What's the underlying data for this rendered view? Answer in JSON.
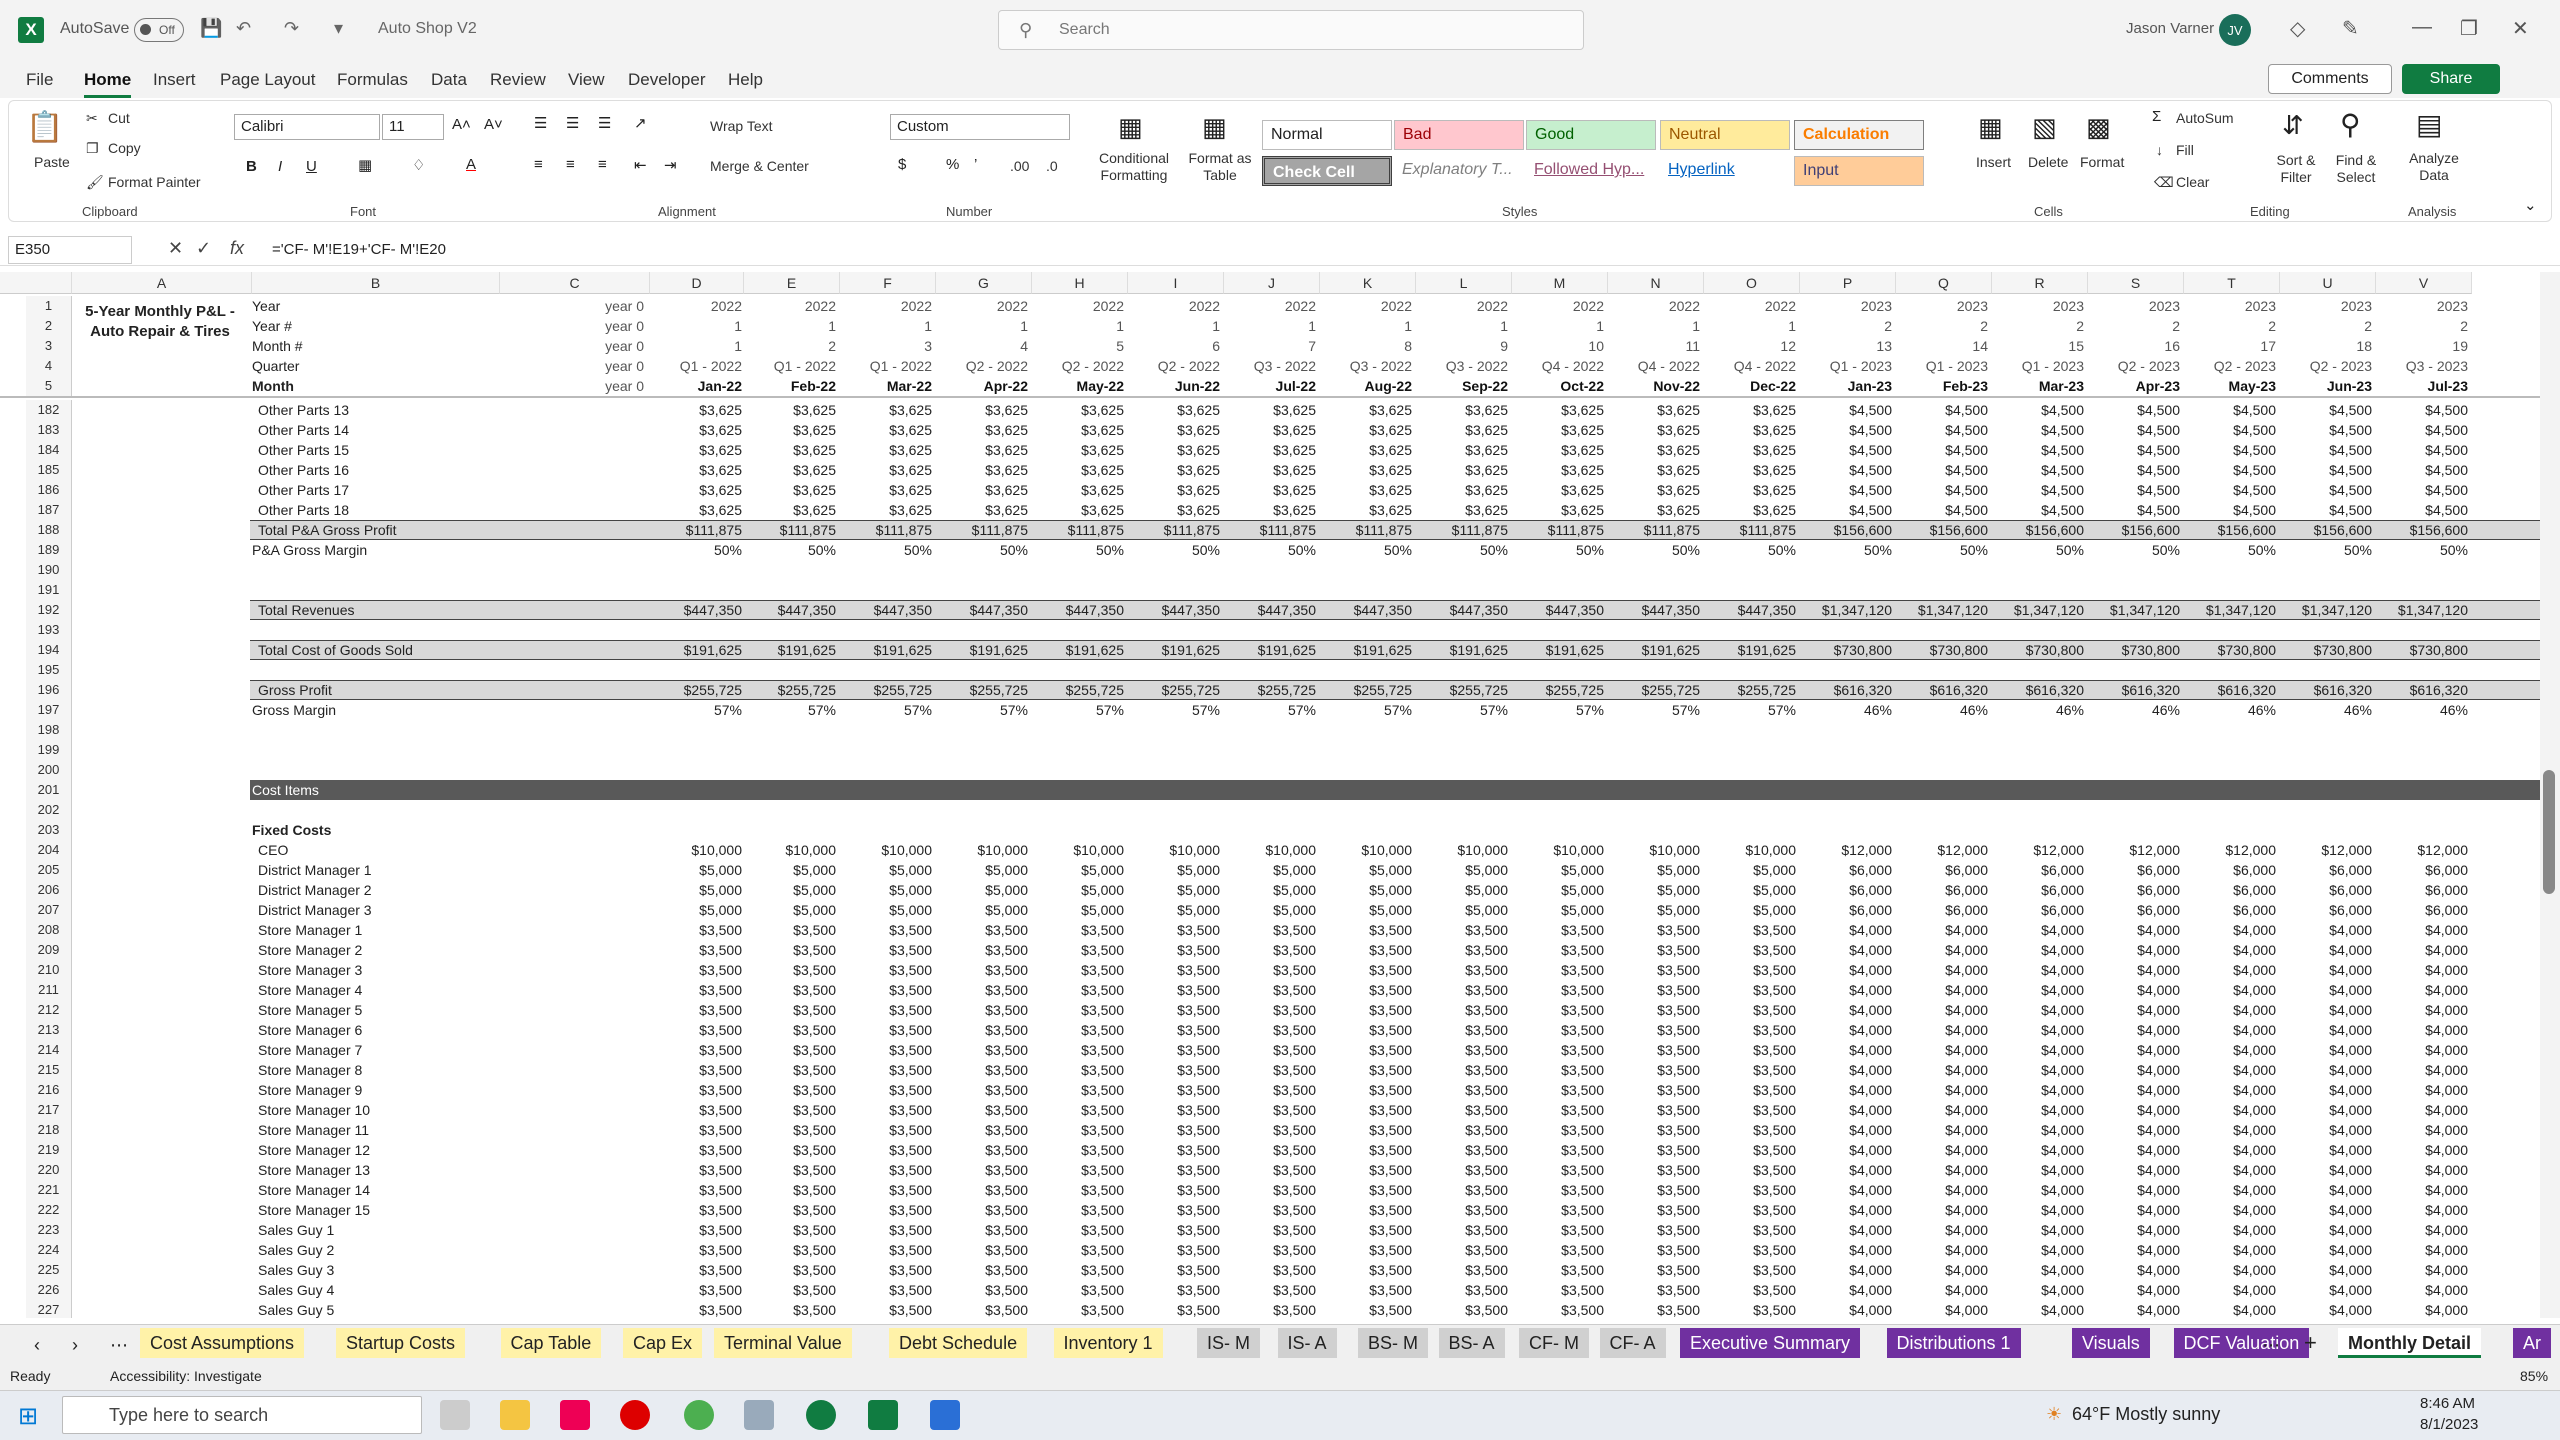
{
  "titlebar": {
    "autosave": "AutoSave",
    "toggle": "Off",
    "doc_title": "Auto Shop V2",
    "search_placeholder": "Search",
    "user": "Jason Varner",
    "initials": "JV"
  },
  "menu": [
    "File",
    "Home",
    "Insert",
    "Page Layout",
    "Formulas",
    "Data",
    "Review",
    "View",
    "Developer",
    "Help"
  ],
  "comments": "Comments",
  "share": "Share",
  "ribbon": {
    "paste": "Paste",
    "cut": "Cut",
    "copy": "Copy",
    "format_painter": "Format Painter",
    "clipboard": "Clipboard",
    "font_name": "Calibri",
    "font_size": "11",
    "font": "Font",
    "wrap_text": "Wrap Text",
    "merge_center": "Merge & Center",
    "alignment": "Alignment",
    "number_format": "Custom",
    "number": "Number",
    "conditional_formatting": "Conditional Formatting",
    "format_as_table": "Format as Table",
    "styles": "Styles",
    "style_normal": "Normal",
    "style_bad": "Bad",
    "style_good": "Good",
    "style_neutral": "Neutral",
    "style_calculation": "Calculation",
    "style_check": "Check Cell",
    "style_explanatory": "Explanatory T...",
    "style_followed": "Followed Hyp...",
    "style_hyperlink": "Hyperlink",
    "style_input": "Input",
    "insert": "Insert",
    "delete": "Delete",
    "format": "Format",
    "cells": "Cells",
    "autosum": "AutoSum",
    "fill": "Fill",
    "clear": "Clear",
    "sort_filter": "Sort & Filter",
    "find_select": "Find & Select",
    "editing": "Editing",
    "analyze_data": "Analyze Data",
    "analysis": "Analysis"
  },
  "formula_bar": {
    "name_box": "E350",
    "formula": "='CF- M'!E19+'CF- M'!E20"
  },
  "sheet": {
    "title": "5-Year Monthly P&L - Auto Repair & Tires",
    "columns": [
      "A",
      "B",
      "C",
      "D",
      "E",
      "F",
      "G",
      "H",
      "I",
      "J",
      "K",
      "L",
      "M",
      "N",
      "O",
      "P",
      "Q",
      "R",
      "S",
      "T",
      "U",
      "V"
    ],
    "header_rows": [
      {
        "n": "1",
        "label": "Year",
        "c": "year 0",
        "vals": [
          "2022",
          "2022",
          "2022",
          "2022",
          "2022",
          "2022",
          "2022",
          "2022",
          "2022",
          "2022",
          "2022",
          "2022",
          "2023",
          "2023",
          "2023",
          "2023",
          "2023",
          "2023",
          "2023"
        ]
      },
      {
        "n": "2",
        "label": "Year #",
        "c": "year 0",
        "vals": [
          "1",
          "1",
          "1",
          "1",
          "1",
          "1",
          "1",
          "1",
          "1",
          "1",
          "1",
          "1",
          "2",
          "2",
          "2",
          "2",
          "2",
          "2",
          "2"
        ]
      },
      {
        "n": "3",
        "label": "Month #",
        "c": "year 0",
        "vals": [
          "1",
          "2",
          "3",
          "4",
          "5",
          "6",
          "7",
          "8",
          "9",
          "10",
          "11",
          "12",
          "13",
          "14",
          "15",
          "16",
          "17",
          "18",
          "19"
        ]
      },
      {
        "n": "4",
        "label": "Quarter",
        "c": "year 0",
        "vals": [
          "Q1 - 2022",
          "Q1 - 2022",
          "Q1 - 2022",
          "Q2 - 2022",
          "Q2 - 2022",
          "Q2 - 2022",
          "Q3 - 2022",
          "Q3 - 2022",
          "Q3 - 2022",
          "Q4 - 2022",
          "Q4 - 2022",
          "Q4 - 2022",
          "Q1 - 2023",
          "Q1 - 2023",
          "Q1 - 2023",
          "Q2 - 2023",
          "Q2 - 2023",
          "Q2 - 2023",
          "Q3 - 2023"
        ]
      },
      {
        "n": "5",
        "label": "Month",
        "c": "year 0",
        "vals": [
          "Jan-22",
          "Feb-22",
          "Mar-22",
          "Apr-22",
          "May-22",
          "Jun-22",
          "Jul-22",
          "Aug-22",
          "Sep-22",
          "Oct-22",
          "Nov-22",
          "Dec-22",
          "Jan-23",
          "Feb-23",
          "Mar-23",
          "Apr-23",
          "May-23",
          "Jun-23",
          "Jul-23"
        ]
      }
    ],
    "rows": [
      {
        "n": "182",
        "label": "Other Parts 13",
        "a": "$3,625",
        "b": "$4,500"
      },
      {
        "n": "183",
        "label": "Other Parts 14",
        "a": "$3,625",
        "b": "$4,500"
      },
      {
        "n": "184",
        "label": "Other Parts 15",
        "a": "$3,625",
        "b": "$4,500"
      },
      {
        "n": "185",
        "label": "Other Parts 16",
        "a": "$3,625",
        "b": "$4,500"
      },
      {
        "n": "186",
        "label": "Other Parts 17",
        "a": "$3,625",
        "b": "$4,500"
      },
      {
        "n": "187",
        "label": "Other Parts 18",
        "a": "$3,625",
        "b": "$4,500"
      },
      {
        "n": "188",
        "label": "Total P&A Gross Profit",
        "a": "$111,875",
        "b": "$156,600",
        "style": "hl"
      },
      {
        "n": "189",
        "label": "P&A Gross Margin",
        "a": "50%",
        "b": "50%"
      },
      {
        "n": "190",
        "label": "",
        "a": "",
        "b": ""
      },
      {
        "n": "191",
        "label": "",
        "a": "",
        "b": ""
      },
      {
        "n": "192",
        "label": "Total Revenues",
        "a": "$447,350",
        "b": "$1,347,120",
        "style": "hl"
      },
      {
        "n": "193",
        "label": "",
        "a": "",
        "b": ""
      },
      {
        "n": "194",
        "label": "Total Cost of Goods Sold",
        "a": "$191,625",
        "b": "$730,800",
        "style": "hl"
      },
      {
        "n": "195",
        "label": "",
        "a": "",
        "b": ""
      },
      {
        "n": "196",
        "label": "Gross Profit",
        "a": "$255,725",
        "b": "$616,320",
        "style": "hl"
      },
      {
        "n": "197",
        "label": "Gross Margin",
        "a": "57%",
        "b": "46%"
      },
      {
        "n": "198",
        "label": "",
        "a": "",
        "b": ""
      },
      {
        "n": "199",
        "label": "",
        "a": "",
        "b": ""
      },
      {
        "n": "200",
        "label": "",
        "a": "",
        "b": ""
      },
      {
        "n": "201",
        "label": "Cost Items",
        "a": "",
        "b": "",
        "style": "dark"
      },
      {
        "n": "202",
        "label": "",
        "a": "",
        "b": ""
      },
      {
        "n": "203",
        "label": "Fixed Costs",
        "a": "",
        "b": "",
        "style": "bold"
      },
      {
        "n": "204",
        "label": "CEO",
        "a": "$10,000",
        "b": "$12,000"
      },
      {
        "n": "205",
        "label": "District Manager 1",
        "a": "$5,000",
        "b": "$6,000"
      },
      {
        "n": "206",
        "label": "District Manager 2",
        "a": "$5,000",
        "b": "$6,000"
      },
      {
        "n": "207",
        "label": "District Manager 3",
        "a": "$5,000",
        "b": "$6,000"
      },
      {
        "n": "208",
        "label": "Store Manager 1",
        "a": "$3,500",
        "b": "$4,000"
      },
      {
        "n": "209",
        "label": "Store Manager 2",
        "a": "$3,500",
        "b": "$4,000"
      },
      {
        "n": "210",
        "label": "Store Manager 3",
        "a": "$3,500",
        "b": "$4,000"
      },
      {
        "n": "211",
        "label": "Store Manager 4",
        "a": "$3,500",
        "b": "$4,000"
      },
      {
        "n": "212",
        "label": "Store Manager 5",
        "a": "$3,500",
        "b": "$4,000"
      },
      {
        "n": "213",
        "label": "Store Manager 6",
        "a": "$3,500",
        "b": "$4,000"
      },
      {
        "n": "214",
        "label": "Store Manager 7",
        "a": "$3,500",
        "b": "$4,000"
      },
      {
        "n": "215",
        "label": "Store Manager 8",
        "a": "$3,500",
        "b": "$4,000"
      },
      {
        "n": "216",
        "label": "Store Manager 9",
        "a": "$3,500",
        "b": "$4,000"
      },
      {
        "n": "217",
        "label": "Store Manager 10",
        "a": "$3,500",
        "b": "$4,000"
      },
      {
        "n": "218",
        "label": "Store Manager 11",
        "a": "$3,500",
        "b": "$4,000"
      },
      {
        "n": "219",
        "label": "Store Manager 12",
        "a": "$3,500",
        "b": "$4,000"
      },
      {
        "n": "220",
        "label": "Store Manager 13",
        "a": "$3,500",
        "b": "$4,000"
      },
      {
        "n": "221",
        "label": "Store Manager 14",
        "a": "$3,500",
        "b": "$4,000"
      },
      {
        "n": "222",
        "label": "Store Manager 15",
        "a": "$3,500",
        "b": "$4,000"
      },
      {
        "n": "223",
        "label": "Sales Guy 1",
        "a": "$3,500",
        "b": "$4,000"
      },
      {
        "n": "224",
        "label": "Sales Guy 2",
        "a": "$3,500",
        "b": "$4,000"
      },
      {
        "n": "225",
        "label": "Sales Guy 3",
        "a": "$3,500",
        "b": "$4,000"
      },
      {
        "n": "226",
        "label": "Sales Guy 4",
        "a": "$3,500",
        "b": "$4,000"
      },
      {
        "n": "227",
        "label": "Sales Guy 5",
        "a": "$3,500",
        "b": "$4,000"
      }
    ]
  },
  "tabs": [
    {
      "label": "Cost Assumptions",
      "color": "#fff2a8",
      "fg": "#222"
    },
    {
      "label": "Startup Costs",
      "color": "#fff2a8",
      "fg": "#222"
    },
    {
      "label": "Cap Table",
      "color": "#fff2a8",
      "fg": "#222"
    },
    {
      "label": "Cap Ex",
      "color": "#fff2a8",
      "fg": "#222"
    },
    {
      "label": "Terminal Value",
      "color": "#fff2a8",
      "fg": "#222"
    },
    {
      "label": "Debt Schedule",
      "color": "#fff2a8",
      "fg": "#222"
    },
    {
      "label": "Inventory 1",
      "color": "#fff2a8",
      "fg": "#222"
    },
    {
      "label": "IS- M",
      "color": "#d0d0d0",
      "fg": "#222"
    },
    {
      "label": "IS- A",
      "color": "#d0d0d0",
      "fg": "#222"
    },
    {
      "label": "BS- M",
      "color": "#d0d0d0",
      "fg": "#222"
    },
    {
      "label": "BS- A",
      "color": "#d0d0d0",
      "fg": "#222"
    },
    {
      "label": "CF- M",
      "color": "#d0d0d0",
      "fg": "#222"
    },
    {
      "label": "CF- A",
      "color": "#d0d0d0",
      "fg": "#222"
    },
    {
      "label": "Executive Summary",
      "color": "#7030a0",
      "fg": "#fff"
    },
    {
      "label": "Distributions 1",
      "color": "#7030a0",
      "fg": "#fff"
    },
    {
      "label": "Visuals",
      "color": "#7030a0",
      "fg": "#fff"
    },
    {
      "label": "DCF Valuation",
      "color": "#7030a0",
      "fg": "#fff"
    },
    {
      "label": "Monthly Detail",
      "color": "#fff",
      "fg": "#222"
    },
    {
      "label": "Ar",
      "color": "#7030a0",
      "fg": "#fff"
    }
  ],
  "status": {
    "ready": "Ready",
    "accessibility": "Accessibility: Investigate",
    "zoom": "85%"
  },
  "taskbar": {
    "search": "Type here to search",
    "weather": "64°F  Mostly sunny",
    "time": "8:46 AM",
    "date": "8/1/2023"
  }
}
